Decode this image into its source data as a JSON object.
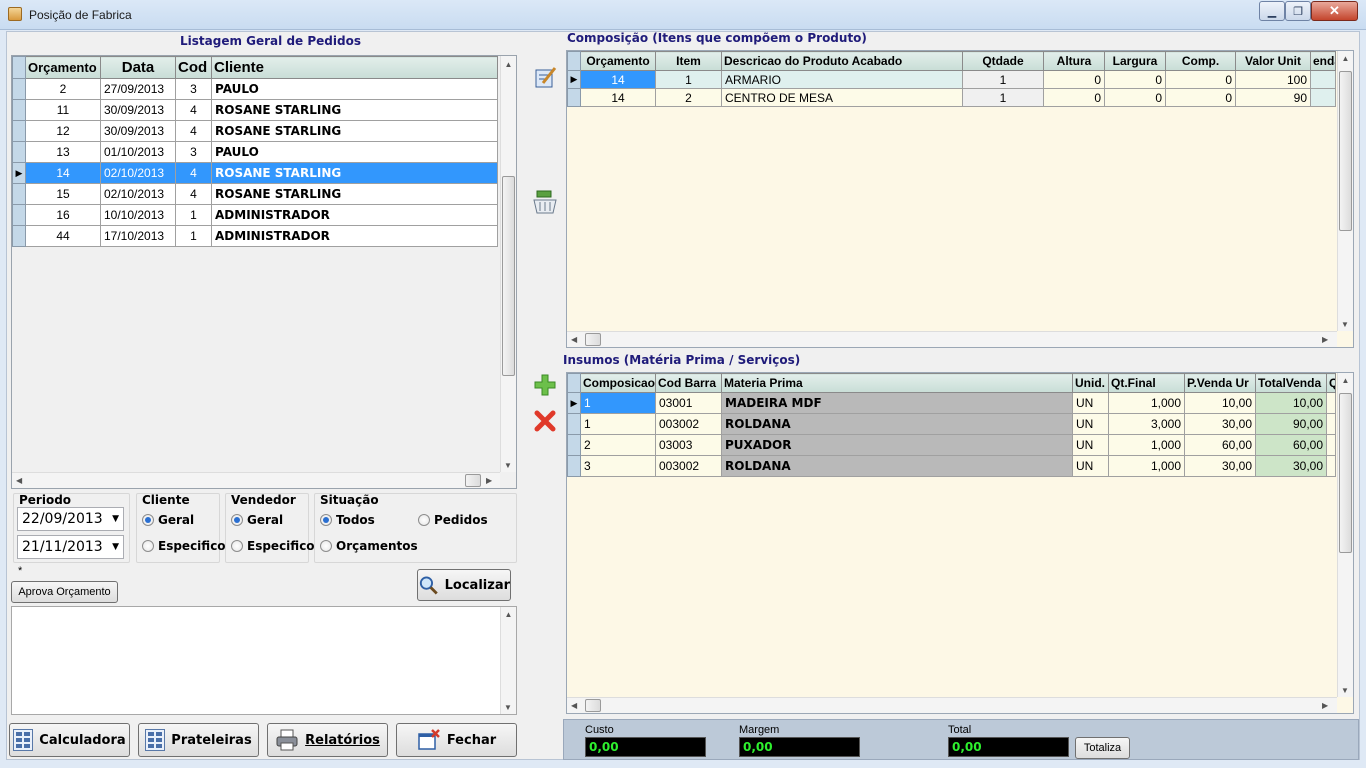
{
  "window": {
    "title": "Posição de Fabrica"
  },
  "left": {
    "title": "Listagem Geral de Pedidos",
    "columns": [
      "Orçamento",
      "Data",
      "Cod",
      "Cliente"
    ],
    "rows": [
      {
        "orcamento": "2",
        "data": "27/09/2013",
        "cod": "3",
        "cliente": "PAULO"
      },
      {
        "orcamento": "11",
        "data": "30/09/2013",
        "cod": "4",
        "cliente": "ROSANE STARLING"
      },
      {
        "orcamento": "12",
        "data": "30/09/2013",
        "cod": "4",
        "cliente": "ROSANE STARLING"
      },
      {
        "orcamento": "13",
        "data": "01/10/2013",
        "cod": "3",
        "cliente": "PAULO"
      },
      {
        "orcamento": "14",
        "data": "02/10/2013",
        "cod": "4",
        "cliente": "ROSANE STARLING"
      },
      {
        "orcamento": "15",
        "data": "02/10/2013",
        "cod": "4",
        "cliente": "ROSANE STARLING"
      },
      {
        "orcamento": "16",
        "data": "10/10/2013",
        "cod": "1",
        "cliente": "ADMINISTRADOR"
      },
      {
        "orcamento": "44",
        "data": "17/10/2013",
        "cod": "1",
        "cliente": "ADMINISTRADOR"
      }
    ]
  },
  "filters": {
    "periodo_label": "Periodo",
    "date_from": "22/09/2013",
    "date_to": "21/11/2013",
    "cliente_label": "Cliente",
    "cliente_options": [
      "Geral",
      "Especifico"
    ],
    "vendedor_label": "Vendedor",
    "vendedor_options": [
      "Geral",
      "Especifico"
    ],
    "situacao_label": "Situação",
    "situacao_options": [
      "Todos",
      "Pedidos",
      "Orçamentos"
    ],
    "asterisk": "*",
    "aprova_label": "Aprova Orçamento",
    "localizar_label": "Localizar"
  },
  "bottom_buttons": {
    "calculadora": "Calculadora",
    "prateleiras": "Prateleiras",
    "relatorios": "Relatórios",
    "fechar": "Fechar"
  },
  "composicao": {
    "title": "Composição (Itens que compõem o Produto)",
    "columns": [
      "Orçamento",
      "Item",
      "Descricao do Produto Acabado",
      "Qtdade",
      "Altura",
      "Largura",
      "Comp.",
      "Valor Unit",
      "enda"
    ],
    "rows": [
      {
        "orcamento": "14",
        "item": "1",
        "descricao": "ARMARIO",
        "qtdade": "1",
        "altura": "0",
        "largura": "0",
        "comp": "0",
        "valor": "100"
      },
      {
        "orcamento": "14",
        "item": "2",
        "descricao": "CENTRO DE MESA",
        "qtdade": "1",
        "altura": "0",
        "largura": "0",
        "comp": "0",
        "valor": "90"
      }
    ]
  },
  "insumos": {
    "title": "Insumos (Matéria Prima / Serviços)",
    "columns": [
      "Composicao",
      "Cod Barra",
      "Materia Prima",
      "Unid.",
      "Qt.Final",
      "P.Venda Ur",
      "TotalVenda",
      "Q"
    ],
    "rows": [
      {
        "composicao": "1",
        "cod": "03001",
        "materia": "MADEIRA MDF",
        "unid": "UN",
        "qt": "1,000",
        "pvenda": "10,00",
        "total": "10,00"
      },
      {
        "composicao": "1",
        "cod": "003002",
        "materia": "ROLDANA",
        "unid": "UN",
        "qt": "3,000",
        "pvenda": "30,00",
        "total": "90,00"
      },
      {
        "composicao": "2",
        "cod": "03003",
        "materia": "PUXADOR",
        "unid": "UN",
        "qt": "1,000",
        "pvenda": "60,00",
        "total": "60,00"
      },
      {
        "composicao": "3",
        "cod": "003002",
        "materia": "ROLDANA",
        "unid": "UN",
        "qt": "1,000",
        "pvenda": "30,00",
        "total": "30,00"
      }
    ]
  },
  "totals": {
    "custo_label": "Custo",
    "custo": "0,00",
    "margem_label": "Margem",
    "margem": "0,00",
    "total_label": "Total",
    "total": "0,00",
    "totaliza_label": "Totaliza"
  }
}
